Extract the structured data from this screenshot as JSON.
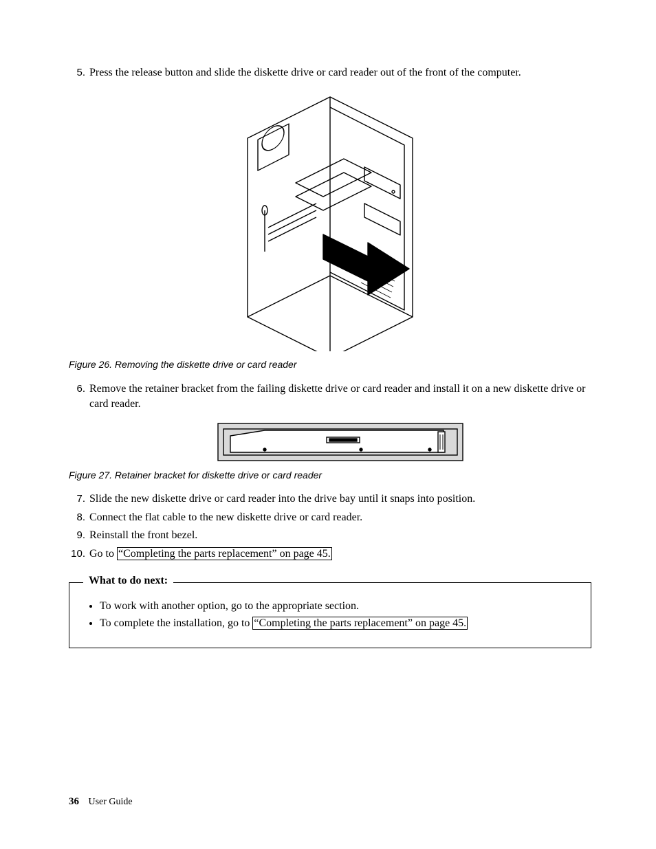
{
  "steps": {
    "s5": {
      "num": "5.",
      "text": "Press the release button and slide the diskette drive or card reader out of the front of the computer."
    },
    "s6": {
      "num": "6.",
      "text": "Remove the retainer bracket from the failing diskette drive or card reader and install it on a new diskette drive or card reader."
    },
    "s7": {
      "num": "7.",
      "text": "Slide the new diskette drive or card reader into the drive bay until it snaps into position."
    },
    "s8": {
      "num": "8.",
      "text": "Connect the flat cable to the new diskette drive or card reader."
    },
    "s9": {
      "num": "9.",
      "text": "Reinstall the front bezel."
    },
    "s10": {
      "num": "10.",
      "pre": "Go to ",
      "link": "“Completing the parts replacement” on page 45."
    }
  },
  "fig26_caption": "Figure 26. Removing the diskette drive or card reader",
  "fig27_caption": "Figure 27. Retainer bracket for diskette drive or card reader",
  "box": {
    "title": "What to do next:",
    "item1": "To work with another option, go to the appropriate section.",
    "item2_pre": "To complete the installation, go to ",
    "item2_link": "“Completing the parts replacement” on page 45."
  },
  "footer": {
    "page": "36",
    "title": "User Guide"
  }
}
